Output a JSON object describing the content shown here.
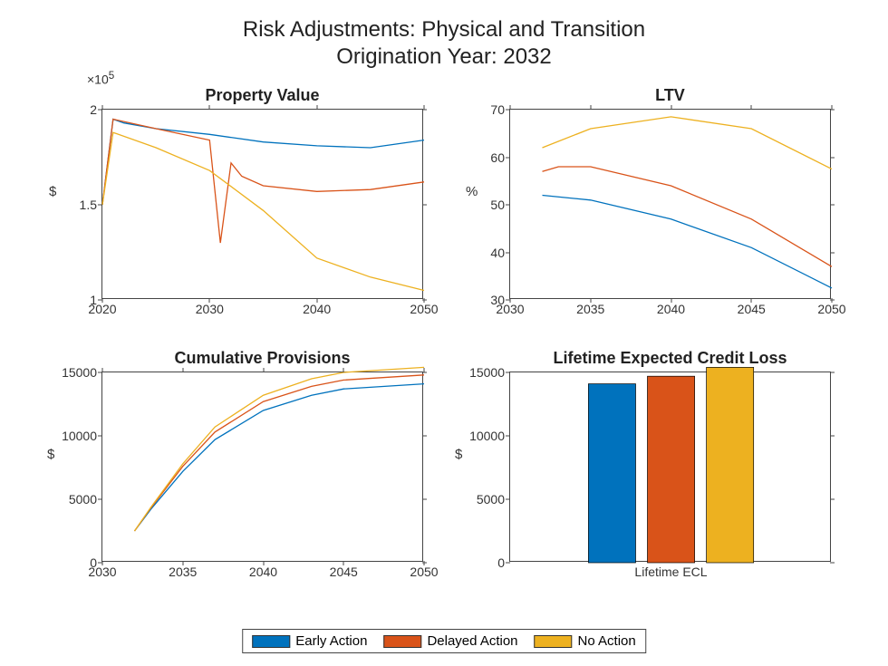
{
  "title_line1": "Risk Adjustments: Physical and Transition",
  "title_line2": "Origination Year: 2032",
  "colors": {
    "early": "#0072BD",
    "delayed": "#D95319",
    "none": "#EDB120"
  },
  "legend": {
    "items": [
      {
        "label": "Early Action"
      },
      {
        "label": "Delayed Action"
      },
      {
        "label": "No Action"
      }
    ]
  },
  "chart_data": [
    {
      "id": "property_value",
      "type": "line",
      "title": "Property Value",
      "xlabel": "",
      "ylabel": "$",
      "y_exponent_label": "×10",
      "y_exponent_sup": "5",
      "xlim": [
        2020,
        2050
      ],
      "ylim": [
        100000,
        200000
      ],
      "xticks": [
        2020,
        2030,
        2040,
        2050
      ],
      "yticks": [
        100000,
        150000,
        200000
      ],
      "ytick_labels": [
        "1",
        "1.5",
        "2"
      ],
      "series": [
        {
          "name": "Early Action",
          "x": [
            2020,
            2021,
            2022,
            2025,
            2030,
            2035,
            2040,
            2045,
            2050
          ],
          "y": [
            150000,
            195000,
            193000,
            190000,
            187000,
            183000,
            181000,
            180000,
            184000
          ]
        },
        {
          "name": "Delayed Action",
          "x": [
            2020,
            2021,
            2025,
            2030,
            2031,
            2032,
            2033,
            2035,
            2040,
            2045,
            2050
          ],
          "y": [
            150000,
            195000,
            190000,
            184000,
            130000,
            172000,
            165000,
            160000,
            157000,
            158000,
            162000
          ]
        },
        {
          "name": "No Action",
          "x": [
            2020,
            2021,
            2025,
            2030,
            2035,
            2040,
            2045,
            2050
          ],
          "y": [
            150000,
            188000,
            180000,
            168000,
            147000,
            122000,
            112000,
            105000
          ]
        }
      ]
    },
    {
      "id": "ltv",
      "type": "line",
      "title": "LTV",
      "xlabel": "",
      "ylabel": "%",
      "xlim": [
        2030,
        2050
      ],
      "ylim": [
        30,
        70
      ],
      "xticks": [
        2030,
        2035,
        2040,
        2045,
        2050
      ],
      "yticks": [
        30,
        40,
        50,
        60,
        70
      ],
      "series": [
        {
          "name": "Early Action",
          "x": [
            2032,
            2035,
            2040,
            2045,
            2050
          ],
          "y": [
            52,
            51,
            47,
            41,
            32.5
          ]
        },
        {
          "name": "Delayed Action",
          "x": [
            2032,
            2033,
            2035,
            2040,
            2045,
            2050
          ],
          "y": [
            57,
            58,
            58,
            54,
            47,
            37
          ]
        },
        {
          "name": "No Action",
          "x": [
            2032,
            2035,
            2040,
            2045,
            2050
          ],
          "y": [
            62,
            66,
            68.5,
            66,
            57.5
          ]
        }
      ]
    },
    {
      "id": "cumulative_provisions",
      "type": "line",
      "title": "Cumulative Provisions",
      "xlabel": "",
      "ylabel": "$",
      "xlim": [
        2030,
        2050
      ],
      "ylim": [
        0,
        15000
      ],
      "xticks": [
        2030,
        2035,
        2040,
        2045,
        2050
      ],
      "yticks": [
        0,
        5000,
        10000,
        15000
      ],
      "series": [
        {
          "name": "Early Action",
          "x": [
            2032,
            2033,
            2035,
            2037,
            2040,
            2043,
            2045,
            2050
          ],
          "y": [
            2500,
            4200,
            7200,
            9700,
            12000,
            13200,
            13700,
            14100
          ]
        },
        {
          "name": "Delayed Action",
          "x": [
            2032,
            2033,
            2035,
            2037,
            2040,
            2043,
            2045,
            2050
          ],
          "y": [
            2500,
            4300,
            7600,
            10300,
            12700,
            13900,
            14400,
            14800
          ]
        },
        {
          "name": "No Action",
          "x": [
            2032,
            2033,
            2035,
            2037,
            2040,
            2043,
            2045,
            2050
          ],
          "y": [
            2500,
            4350,
            7800,
            10700,
            13200,
            14500,
            15000,
            15400
          ]
        }
      ]
    },
    {
      "id": "lifetime_ecl",
      "type": "bar",
      "title": "Lifetime Expected Credit Loss",
      "xlabel": "",
      "ylabel": "$",
      "ylim": [
        0,
        15000
      ],
      "yticks": [
        0,
        5000,
        10000,
        15000
      ],
      "categories": [
        "Lifetime ECL"
      ],
      "series": [
        {
          "name": "Early Action",
          "values": [
            14100
          ]
        },
        {
          "name": "Delayed Action",
          "values": [
            14700
          ]
        },
        {
          "name": "No Action",
          "values": [
            15400
          ]
        }
      ]
    }
  ]
}
